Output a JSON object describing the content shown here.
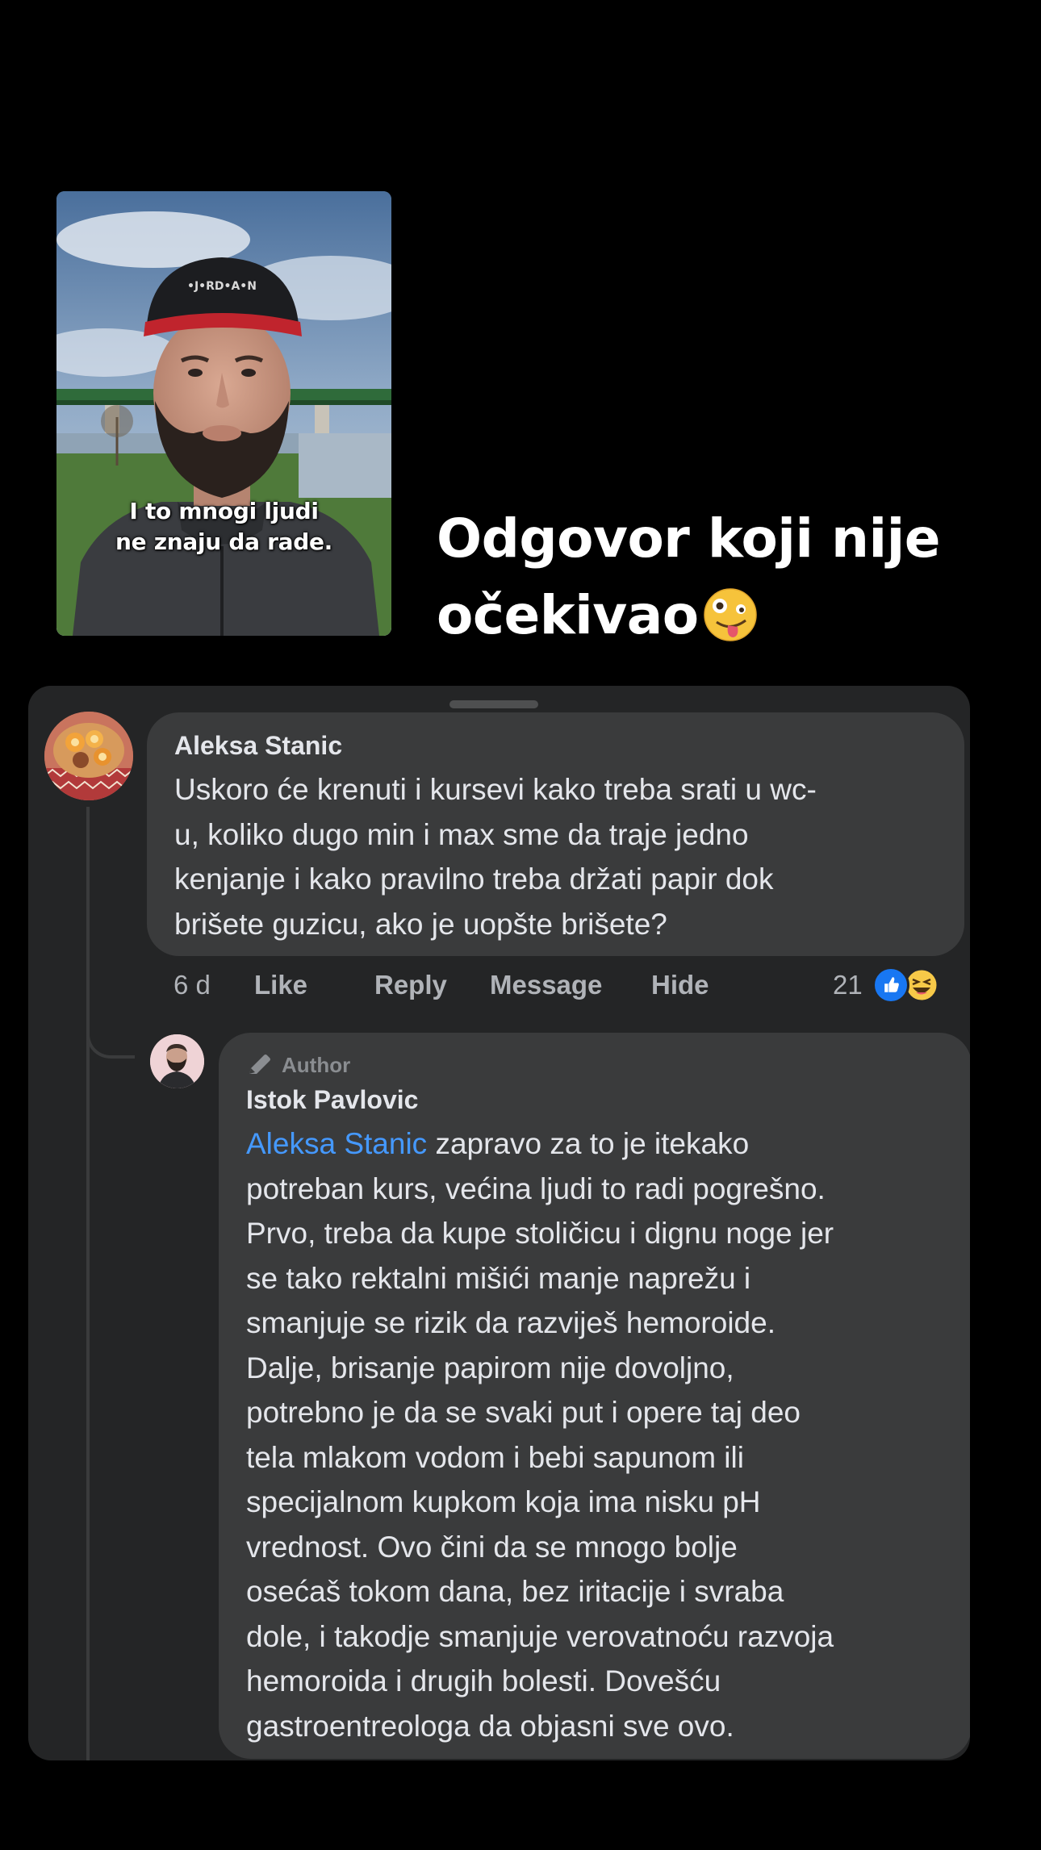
{
  "video": {
    "caption_lines": [
      "I to mnogi ljudi",
      "ne znaju da rade."
    ]
  },
  "headline": {
    "line1": "Odgovor koji nije",
    "line2": "očekivao",
    "emoji": "zany-face-emoji"
  },
  "comment": {
    "author": "Aleksa Stanic",
    "text_lines": [
      "Uskoro će krenuti i kursevi kako treba srati u wc-",
      "u, koliko dugo min i max sme da traje jedno",
      "kenjanje i kako pravilno treba držati papir dok",
      "brišete guzicu, ako je uopšte brišete?"
    ],
    "time": "6 d",
    "actions": {
      "like": "Like",
      "reply": "Reply",
      "message": "Message",
      "hide": "Hide"
    },
    "reaction_count": "21",
    "reaction_icons": [
      "like-icon",
      "haha-icon"
    ]
  },
  "reply": {
    "badge": "Author",
    "author": "Istok Pavlovic",
    "mention": "Aleksa Stanic",
    "first_line_rest": " zapravo za to je itekako",
    "text_lines": [
      "potreban kurs, većina ljudi to radi pogrešno.",
      "Prvo, treba da kupe stoličicu i dignu noge jer",
      "se tako rektalni mišići manje naprežu i",
      "smanjuje se rizik da razviješ hemoroide.",
      "Dalje, brisanje papirom nije dovoljno,",
      "potrebno je da se svaki put i opere taj deo",
      "tela mlakom vodom i bebi sapunom ili",
      "specijalnom kupkom koja ima nisku pH",
      "vrednost. Ovo čini da se mnogo bolje",
      "osećaš tokom dana, bez iritacije i svraba",
      "dole, i takodje smanjuje verovatnoću razvoja",
      "hemoroida i drugih bolesti. Dovešću",
      "gastroentreologa da objasni sve ovo."
    ]
  },
  "colors": {
    "background": "#000000",
    "panel": "#242526",
    "bubble": "#3a3b3c",
    "text": "#e4e6eb",
    "muted": "#b0b3b8",
    "mention": "#4599ff",
    "like_blue": "#1877f2"
  }
}
